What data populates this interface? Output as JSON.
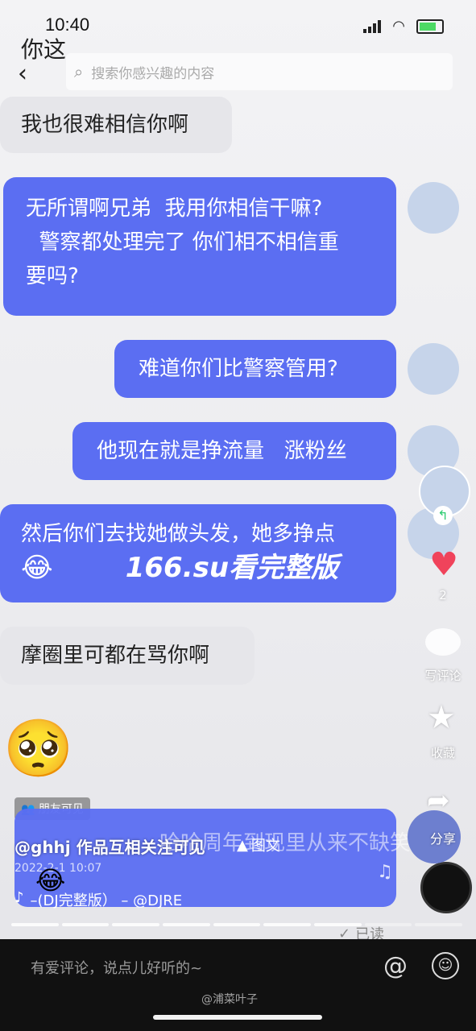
{
  "status": {
    "time": "10:40"
  },
  "header": {
    "title": "你这",
    "search_placeholder": "搜索你感兴趣的内容"
  },
  "messages": [
    {
      "text": "我也很难相信你啊"
    },
    {
      "lines": [
        "无所谓啊兄弟  我用你相信干嘛?",
        "  警察都处理完了 你们相不相信重",
        "要吗?"
      ]
    },
    {
      "text": "难道你们比警察管用?"
    },
    {
      "text": "他现在就是挣流量   涨粉丝"
    },
    {
      "text": "然后你们去找她做头发，她多挣点"
    },
    {
      "text": "摩圈里可都在骂你啊"
    }
  ],
  "watermark": "166.su看完整版",
  "overlay": {
    "friends_label": "朋友可见",
    "author_line": "@ghhj 作品互相关注可见",
    "text_badge": "图文",
    "caption_text": "哈哈周年到现里从来不缺笑话",
    "date": "2022-2-1 10:07",
    "music": "–(DJ完整版） – @DJRE"
  },
  "sidebar": {
    "like_count": "2",
    "comment_label": "写评论",
    "favorite_label": "收藏",
    "share_label": "分享"
  },
  "read_status": "已读",
  "comment_placeholder": "有爱评论，说点儿好听的~",
  "weibo_watermark": "@浦菜叶子",
  "colors": {
    "bubble_blue": "#5b6ef2",
    "like_red": "#f0435b"
  }
}
